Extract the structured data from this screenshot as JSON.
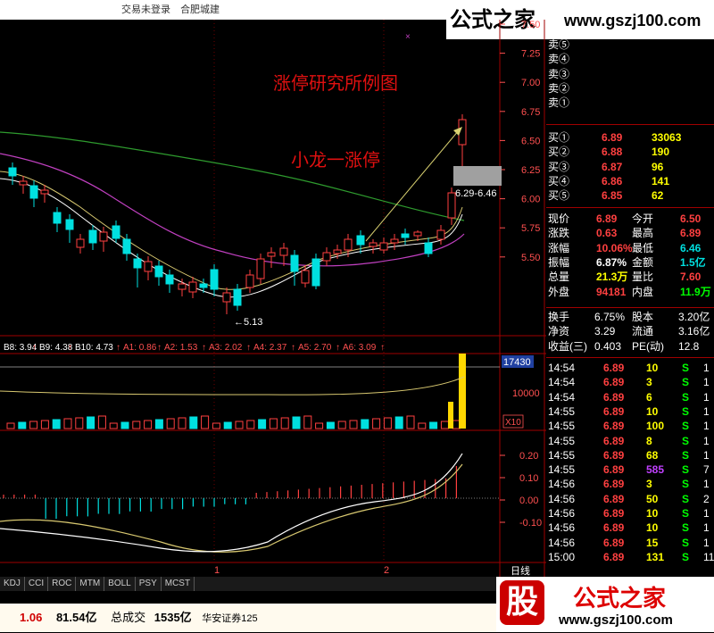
{
  "title_bar": {
    "status": "交易未登录",
    "stock_name": "合肥城建"
  },
  "watermark": {
    "brand": "公式之家",
    "url": "www.gszj100.com",
    "logo_char": "股"
  },
  "annotations": {
    "title": "涨停研究所例图",
    "subtitle": "小龙一涨停",
    "range_label": "6.29-6.46",
    "low_label": "←5.13"
  },
  "price_axis": [
    "7.50",
    "7.25",
    "7.00",
    "6.75",
    "6.50",
    "6.25",
    "6.00",
    "5.75",
    "5.50"
  ],
  "indicator_line": [
    {
      "label": "B8: 3.94",
      "color": "#ffffff"
    },
    {
      "label": "B9: 4.38",
      "color": "#ffffff"
    },
    {
      "label": "B10: 4.73",
      "color": "#ffffff"
    },
    {
      "label": "A1: 0.86",
      "color": "#ff5050"
    },
    {
      "label": "A2: 1.53",
      "color": "#ff5050"
    },
    {
      "label": "A3: 2.02",
      "color": "#ff5050"
    },
    {
      "label": "A4: 2.37",
      "color": "#ff5050"
    },
    {
      "label": "A5: 2.70",
      "color": "#ff5050"
    },
    {
      "label": "A6: 3.09",
      "color": "#ff5050"
    }
  ],
  "volume_axis": {
    "max_label": "17430",
    "mid_label": "10000",
    "unit": "X10"
  },
  "macd_axis": [
    "0.20",
    "0.10",
    "0.00",
    "-0.10"
  ],
  "x_axis": {
    "marks": [
      "1",
      "2"
    ],
    "period": "日线"
  },
  "order_book": {
    "sell": [
      {
        "label": "卖⑤",
        "price": "",
        "vol": ""
      },
      {
        "label": "卖④",
        "price": "",
        "vol": ""
      },
      {
        "label": "卖③",
        "price": "",
        "vol": ""
      },
      {
        "label": "卖②",
        "price": "",
        "vol": ""
      },
      {
        "label": "卖①",
        "price": "",
        "vol": ""
      }
    ],
    "buy": [
      {
        "label": "买①",
        "price": "6.89",
        "vol": "33063"
      },
      {
        "label": "买②",
        "price": "6.88",
        "vol": "190"
      },
      {
        "label": "买③",
        "price": "6.87",
        "vol": "96"
      },
      {
        "label": "买④",
        "price": "6.86",
        "vol": "141"
      },
      {
        "label": "买⑤",
        "price": "6.85",
        "vol": "62"
      }
    ]
  },
  "quote": [
    {
      "k1": "现价",
      "v1": "6.89",
      "k2": "今开",
      "v2": "6.50"
    },
    {
      "k1": "涨跌",
      "v1": "0.63",
      "k2": "最高",
      "v2": "6.89"
    },
    {
      "k1": "涨幅",
      "v1": "10.06%",
      "k2": "最低",
      "v2": "6.46"
    },
    {
      "k1": "振幅",
      "v1": "6.87%",
      "k2": "金额",
      "v2": "1.5亿"
    },
    {
      "k1": "总量",
      "v1": "21.3万",
      "k2": "量比",
      "v2": "7.60"
    },
    {
      "k1": "外盘",
      "v1": "94181",
      "k2": "内盘",
      "v2": "11.9万"
    }
  ],
  "fundamentals": [
    {
      "k1": "换手",
      "v1": "6.75%",
      "k2": "股本",
      "v2": "3.20亿"
    },
    {
      "k1": "净资",
      "v1": "3.29",
      "k2": "流通",
      "v2": "3.16亿"
    },
    {
      "k1": "收益(三)",
      "v1": "0.403",
      "k2": "PE(动)",
      "v2": "12.8"
    }
  ],
  "ticks": [
    {
      "time": "14:54",
      "price": "6.89",
      "vol": "10",
      "side": "S",
      "n": "1"
    },
    {
      "time": "14:54",
      "price": "6.89",
      "vol": "3",
      "side": "S",
      "n": "1"
    },
    {
      "time": "14:54",
      "price": "6.89",
      "vol": "6",
      "side": "S",
      "n": "1"
    },
    {
      "time": "14:55",
      "price": "6.89",
      "vol": "10",
      "side": "S",
      "n": "1"
    },
    {
      "time": "14:55",
      "price": "6.89",
      "vol": "100",
      "side": "S",
      "n": "1"
    },
    {
      "time": "14:55",
      "price": "6.89",
      "vol": "8",
      "side": "S",
      "n": "1"
    },
    {
      "time": "14:55",
      "price": "6.89",
      "vol": "68",
      "side": "S",
      "n": "1"
    },
    {
      "time": "14:55",
      "price": "6.89",
      "vol": "585",
      "side": "S",
      "n": "7"
    },
    {
      "time": "14:56",
      "price": "6.89",
      "vol": "3",
      "side": "S",
      "n": "1"
    },
    {
      "time": "14:56",
      "price": "6.89",
      "vol": "50",
      "side": "S",
      "n": "2"
    },
    {
      "time": "14:56",
      "price": "6.89",
      "vol": "10",
      "side": "S",
      "n": "1"
    },
    {
      "time": "14:56",
      "price": "6.89",
      "vol": "10",
      "side": "S",
      "n": "1"
    },
    {
      "time": "14:56",
      "price": "6.89",
      "vol": "15",
      "side": "S",
      "n": "1"
    },
    {
      "time": "15:00",
      "price": "6.89",
      "vol": "131",
      "side": "S",
      "n": "11"
    }
  ],
  "indicator_tabs": [
    "KDJ",
    "CCI",
    "ROC",
    "MTM",
    "BOLL",
    "PSY",
    "MCST"
  ],
  "status_bar": {
    "v1": "1.06",
    "v2": "81.54亿",
    "label": "总成交",
    "v3": "1535亿",
    "broker": "华安证券125"
  },
  "colors": {
    "up": "#ff4040",
    "down": "#00e0e0",
    "yellow": "#ffff00",
    "ma_green": "#2e9b2e",
    "ma_purple": "#c040c0"
  }
}
